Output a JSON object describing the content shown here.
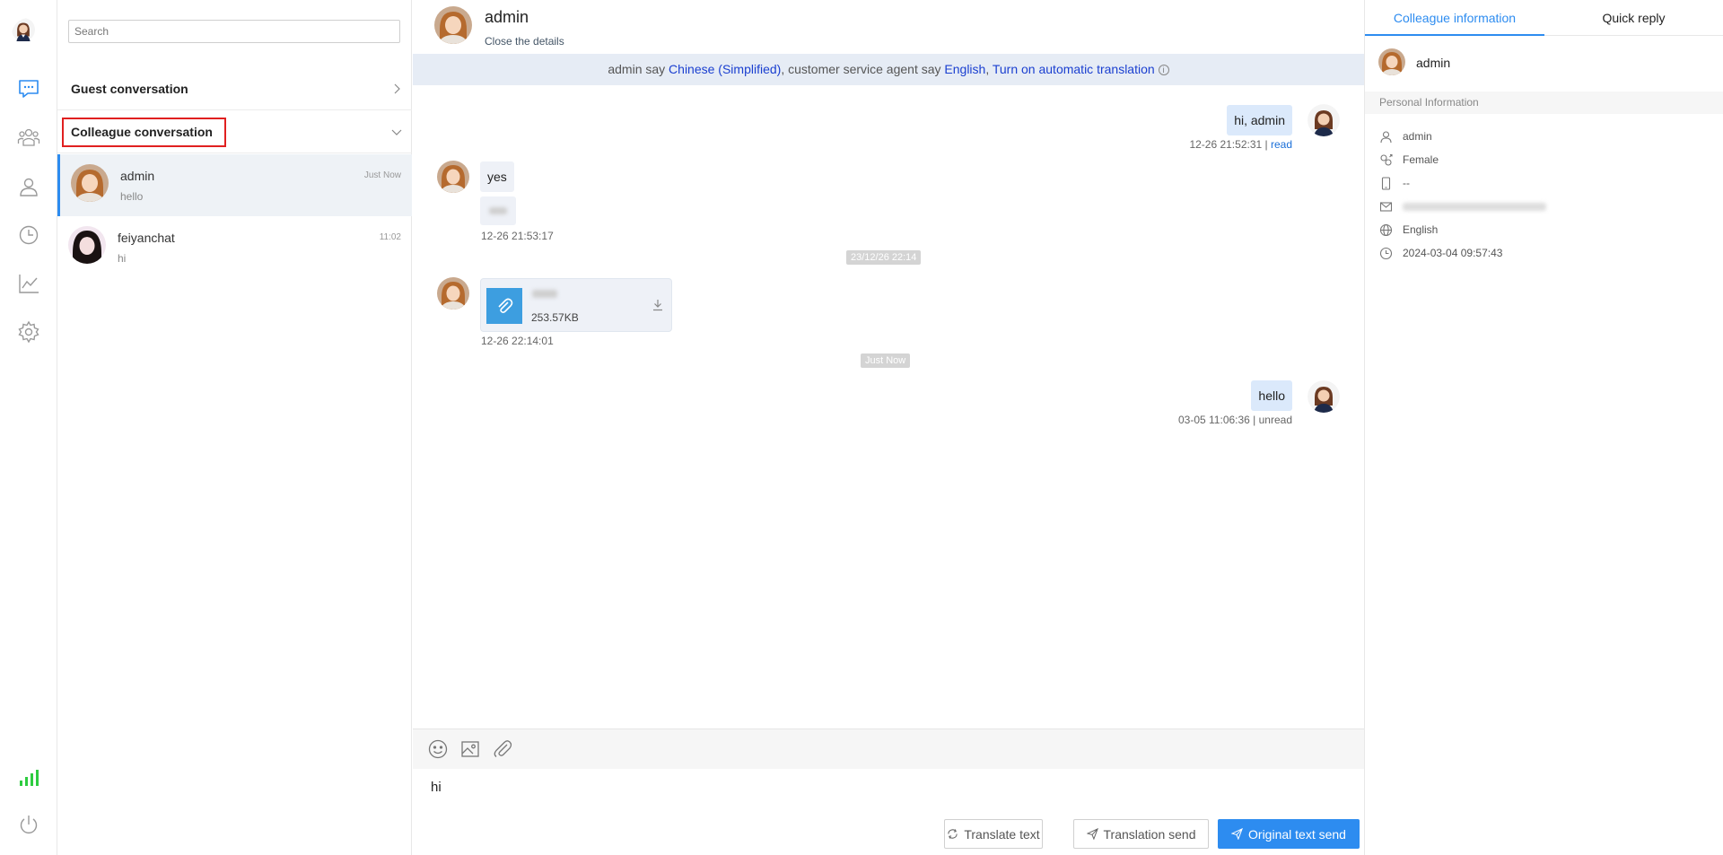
{
  "rail": {
    "icons": [
      "avatar",
      "chat-icon",
      "team-icon",
      "user-icon",
      "history-icon",
      "chart-icon",
      "settings-icon",
      "signal-icon",
      "power-icon"
    ],
    "accent": "#2d8cf0",
    "signal_color": "#2ecc40"
  },
  "list": {
    "search_placeholder": "Search",
    "sections": [
      {
        "title": "Guest conversation",
        "expanded": false
      },
      {
        "title": "Colleague conversation",
        "expanded": true
      }
    ],
    "conversations": [
      {
        "name": "admin",
        "preview": "hello",
        "time": "Just Now",
        "active": true
      },
      {
        "name": "feiyanchat",
        "preview": "hi",
        "time": "11:02",
        "active": false
      }
    ]
  },
  "chat": {
    "contact_name": "admin",
    "close_details": "Close the details",
    "translation_bar": {
      "part1": "admin say ",
      "lang_contact": "Chinese (Simplified)",
      "part2": ", customer service agent say ",
      "lang_agent": "English",
      "part3": ", ",
      "toggle": "Turn on automatic translation",
      "info_icon": "i"
    },
    "messages": {
      "m1": {
        "text": "hi, admin",
        "time": "12-26 21:52:31 | ",
        "status": "read"
      },
      "m2": {
        "text": "yes",
        "time": "12-26 21:53:17"
      },
      "sep1": "23/12/26 22:14",
      "m3": {
        "file_size": "253.57KB",
        "time": "12-26 22:14:01"
      },
      "sep2": "Just Now",
      "m4": {
        "text": "hello",
        "time": "03-05 11:06:36 | unread"
      }
    },
    "toolbar": [
      "emoji-icon",
      "image-icon",
      "attach-icon"
    ],
    "input_value": "hi",
    "buttons": {
      "translate_text": "Translate text",
      "translation_send": "Translation send",
      "original_send": "Original text send"
    }
  },
  "right": {
    "tabs": [
      "Colleague information",
      "Quick reply"
    ],
    "name": "admin",
    "section_title": "Personal Information",
    "fields": {
      "username": "admin",
      "gender": "Female",
      "phone": "--",
      "language": "English",
      "created": "2024-03-04 09:57:43"
    }
  }
}
